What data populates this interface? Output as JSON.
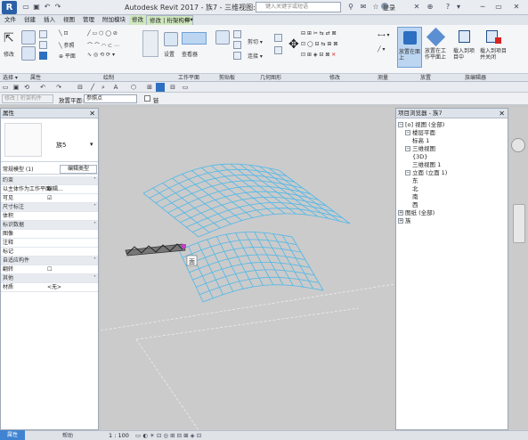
{
  "app": {
    "logo": "R",
    "title": "Autodesk Revit 2017 -    族7 - 三维视图: {3D}",
    "search_placeholder": "键入关键字或短语",
    "login": "登录",
    "help": "?"
  },
  "menu_tabs": [
    "文件",
    "创建",
    "插入",
    "视图",
    "管理",
    "附加模块",
    "修改",
    "修改 | 桁架构件",
    "⊡▾"
  ],
  "ribbon": {
    "modify_label": "修改",
    "select_label": "选择 ▾",
    "properties_label": "属性",
    "draw_label": "绘制",
    "workplane_set": "设置",
    "workplane_viewer": "查看器",
    "workplane_label": "工作平面",
    "clipboard_label": "剪贴板",
    "geometry_label": "几何图形",
    "cut_label": "剪切 ▾",
    "join_label": "连接 ▾",
    "modify_group_label": "修改",
    "measure_label": "测量",
    "create_label": "创建",
    "set_on_face": "放置在面上",
    "set_on_workplane": "放置在工作平面上",
    "placement_label": "放置",
    "load_into_project": "载入到项目中",
    "load_close": "载入到项目并关闭",
    "family_editor_label": "族编辑器"
  },
  "optbar": {
    "ref_label": "修改 | 桁架构件",
    "placement_plane_label": "放置平面:",
    "placement_plane_value": "参照点",
    "chain_label": "链"
  },
  "properties": {
    "title": "属性",
    "type_name": "族5",
    "selector_value": "常规模型 (1)",
    "edit_type": "编辑类型",
    "rows": [
      {
        "kind": "cat",
        "name": "约束"
      },
      {
        "kind": "row",
        "name": "以主体作为工作平面",
        "value": "编辑..."
      },
      {
        "kind": "row",
        "name": "可见",
        "value": "☑"
      },
      {
        "kind": "cat",
        "name": "尺寸标注"
      },
      {
        "kind": "row",
        "name": "体积",
        "value": ""
      },
      {
        "kind": "cat",
        "name": "标识数据"
      },
      {
        "kind": "row",
        "name": "图像",
        "value": ""
      },
      {
        "kind": "row",
        "name": "注释",
        "value": ""
      },
      {
        "kind": "row",
        "name": "标记",
        "value": ""
      },
      {
        "kind": "cat",
        "name": "自适应构件"
      },
      {
        "kind": "row",
        "name": "翻转",
        "value": "☐"
      },
      {
        "kind": "cat",
        "name": "其他"
      },
      {
        "kind": "row",
        "name": "材质",
        "value": "<无>"
      }
    ]
  },
  "viewport": {
    "label_marker": "面"
  },
  "browser": {
    "title": "项目浏览器 - 族7",
    "tree": [
      {
        "level": 0,
        "box": "−",
        "label": "[o] 视图 (全部)"
      },
      {
        "level": 1,
        "box": "−",
        "label": "楼层平面"
      },
      {
        "level": 2,
        "box": "",
        "label": "标高 1"
      },
      {
        "level": 1,
        "box": "−",
        "label": "三维视图"
      },
      {
        "level": 2,
        "box": "",
        "label": "{3D}"
      },
      {
        "level": 2,
        "box": "",
        "label": "三维视图 1"
      },
      {
        "level": 1,
        "box": "−",
        "label": "立面 (立面 1)"
      },
      {
        "level": 2,
        "box": "",
        "label": "东"
      },
      {
        "level": 2,
        "box": "",
        "label": "北"
      },
      {
        "level": 2,
        "box": "",
        "label": "南"
      },
      {
        "level": 2,
        "box": "",
        "label": "西"
      },
      {
        "level": 0,
        "box": "+",
        "label": "图纸 (全部)"
      },
      {
        "level": 0,
        "box": "+",
        "label": "族"
      }
    ]
  },
  "status": {
    "props_tab": "属性",
    "browser_tab": "帮助",
    "scale": "1 : 100"
  },
  "colors": {
    "accent": "#2d6fc0",
    "surface_grid": "#4fb8e8",
    "point": "#c040c0"
  }
}
